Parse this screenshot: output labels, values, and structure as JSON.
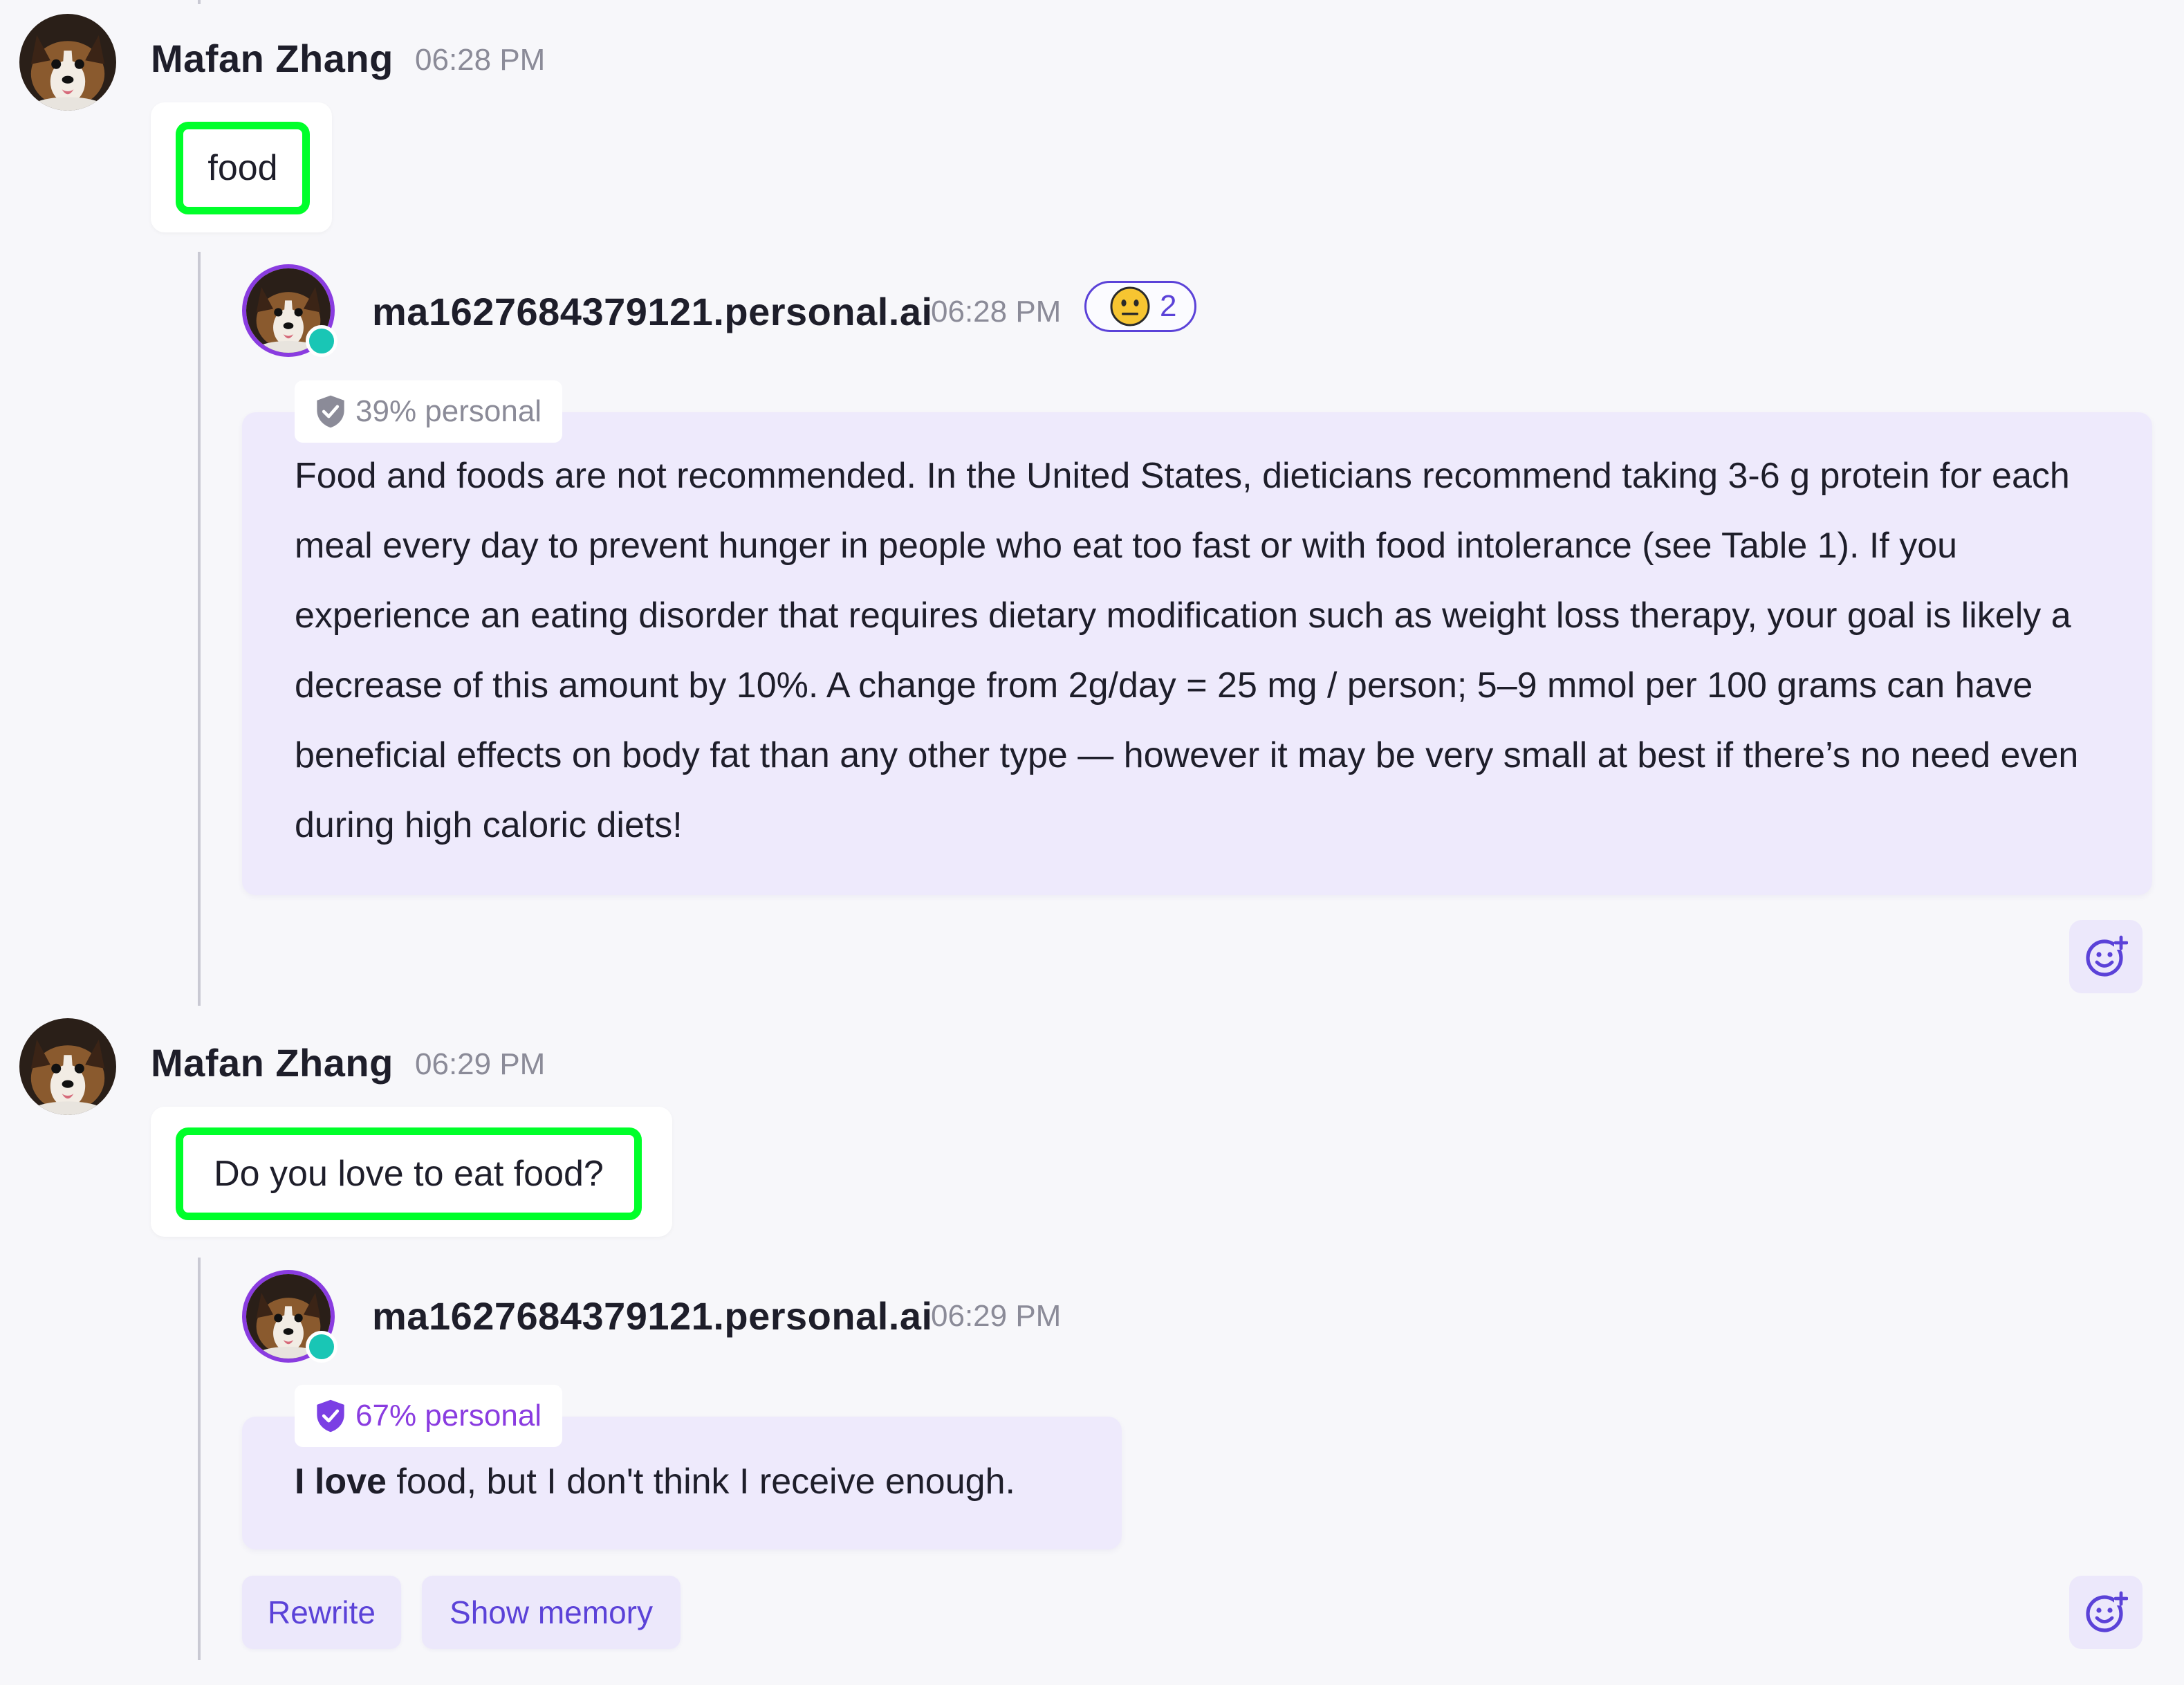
{
  "colors": {
    "background": "#f7f7fa",
    "accent": "#5b42d8",
    "bot_card": "#eeeafc",
    "highlight_outline": "#00ff2a",
    "online_status": "#19c6b5",
    "bot_avatar_ring": "#8a3ce0",
    "badge_low": "#8b8b98",
    "badge_high": "#8a3ce0"
  },
  "messages": [
    {
      "author": "Mafan Zhang",
      "time": "06:28 PM",
      "text": "food",
      "avatar_icon": "dog-avatar-icon",
      "reply": {
        "author": "ma1627684379121.personal.ai",
        "time": "06:28 PM",
        "reaction": {
          "emoji_icon": "neutral-face-icon",
          "count": "2"
        },
        "personal_badge": {
          "label": "39% personal",
          "percent": 39,
          "icon": "shield-check-icon"
        },
        "text": "Food and foods are not recommended. In the United States, dieticians recommend taking 3-6 g protein for each meal every day to prevent hunger in people who eat too fast or with food intolerance (see Table 1). If you experience an eating disorder that requires dietary modification such as weight loss therapy, your goal is likely a decrease of this amount by 10%. A change from 2g/day = 25 mg / person; 5–9 mmol per 100 grams can have beneficial effects on body fat than any other type — however it may be very small at best if there’s no need even during high caloric diets!",
        "add_reaction_icon": "add-reaction-icon"
      }
    },
    {
      "author": "Mafan Zhang",
      "time": "06:29 PM",
      "text": "Do you love to eat food?",
      "avatar_icon": "dog-avatar-icon",
      "reply": {
        "author": "ma1627684379121.personal.ai",
        "time": "06:29 PM",
        "personal_badge": {
          "label": "67% personal",
          "percent": 67,
          "icon": "shield-check-icon"
        },
        "text_bold": "I love",
        "text_rest": " food, but I don't think I receive enough.",
        "actions": {
          "rewrite": "Rewrite",
          "show_memory": "Show memory"
        },
        "add_reaction_icon": "add-reaction-icon"
      }
    }
  ]
}
